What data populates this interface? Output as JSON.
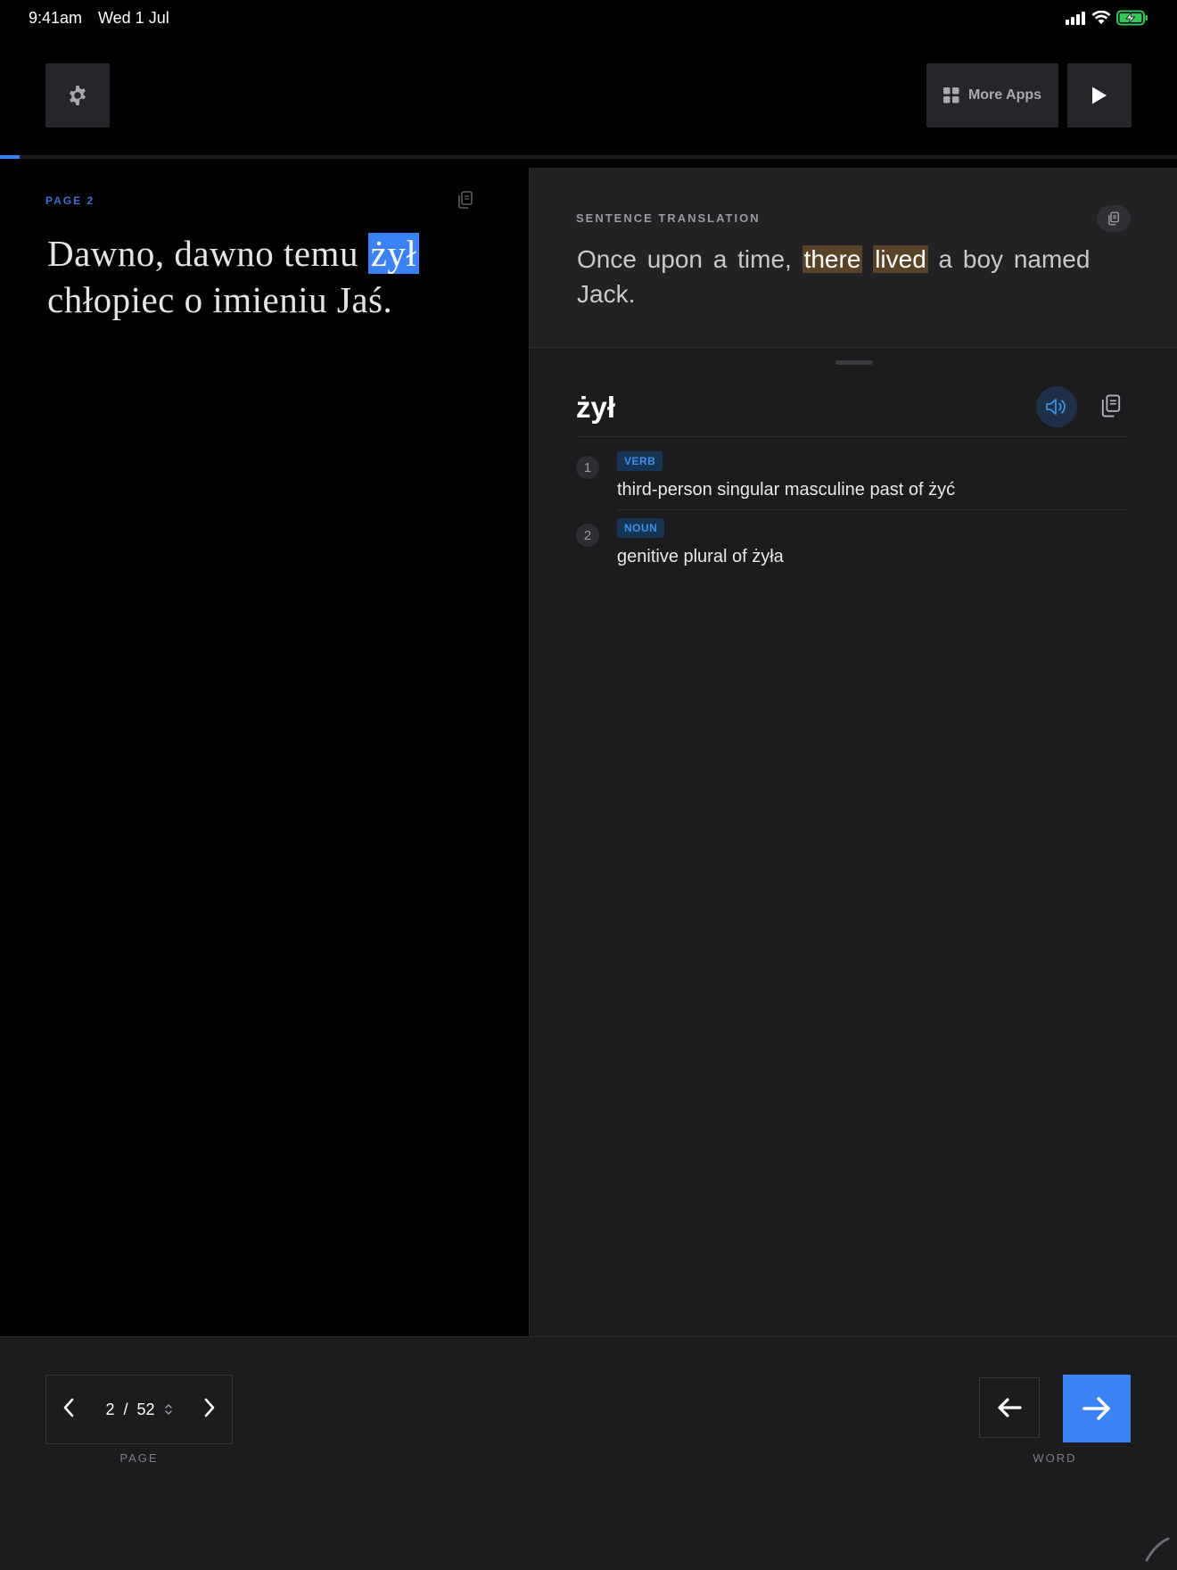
{
  "status_bar": {
    "time": "9:41am",
    "date": "Wed 1 Jul",
    "icons": [
      "signal-icon",
      "wifi-icon",
      "battery-charging-icon"
    ],
    "battery_color": "#34c759"
  },
  "toolbar": {
    "settings_icon": "gear-icon",
    "more_apps_label": "More Apps",
    "play_icon": "play-icon"
  },
  "progress": {
    "fraction": 0.017,
    "color": "#3b82f6"
  },
  "source": {
    "page_label": "PAGE  2",
    "text_before": "Dawno, dawno temu ",
    "highlighted_word": "żył",
    "text_after": " chłopiec o imieniu Jaś."
  },
  "translation": {
    "label": "SENTENCE TRANSLATION",
    "text_before": "Once upon a time, ",
    "highlight_1": "there",
    "highlight_2": "lived",
    "text_after": " a boy named Jack."
  },
  "dictionary": {
    "headword": "żył",
    "entries": [
      {
        "num": "1",
        "pos": "VERB",
        "definition": "third-person singular masculine past of żyć"
      },
      {
        "num": "2",
        "pos": "NOUN",
        "definition": "genitive plural of żyła"
      }
    ]
  },
  "bottom": {
    "current_page": "2",
    "separator": "/",
    "total_pages": "52",
    "page_caption": "PAGE",
    "word_caption": "WORD"
  },
  "colors": {
    "accent": "#3b82f6",
    "translation_highlight": "#5a4226",
    "badge_bg": "#173454",
    "badge_text": "#3b8fe8"
  }
}
